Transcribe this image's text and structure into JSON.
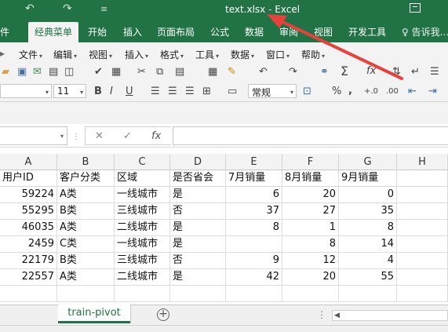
{
  "window": {
    "title": "text.xlsx - Excel",
    "quick_access": [
      "↶",
      "↷",
      "≡"
    ]
  },
  "ribbon_tabs": [
    "件",
    "经典菜单",
    "开始",
    "插入",
    "页面布局",
    "公式",
    "数据",
    "审阅",
    "视图",
    "开发工具"
  ],
  "tell_me": "告诉我...",
  "classic_menu": [
    "文件",
    "编辑",
    "视图",
    "插入",
    "格式",
    "工具",
    "数据",
    "窗口",
    "帮助"
  ],
  "toolbar": {
    "font_size": "11",
    "number_format": "常规",
    "percent": "%",
    "comma": ","
  },
  "formula_bar": {
    "fx_label": "fx",
    "cancel_label": "✕",
    "enter_label": "✓",
    "value": ""
  },
  "grid": {
    "columns": [
      "A",
      "B",
      "C",
      "D",
      "E",
      "F",
      "G",
      "H"
    ],
    "header_row": [
      "用户ID",
      "客户分类",
      "区域",
      "是否省会",
      "7月销量",
      "8月销量",
      "9月销量",
      ""
    ],
    "rows": [
      [
        "59224",
        "A类",
        "一线城市",
        "是",
        "6",
        "20",
        "0",
        ""
      ],
      [
        "55295",
        "B类",
        "三线城市",
        "否",
        "37",
        "27",
        "35",
        ""
      ],
      [
        "46035",
        "A类",
        "二线城市",
        "是",
        "8",
        "1",
        "8",
        ""
      ],
      [
        "2459",
        "C类",
        "一线城市",
        "是",
        "",
        "8",
        "14",
        ""
      ],
      [
        "22179",
        "B类",
        "三线城市",
        "否",
        "9",
        "12",
        "4",
        ""
      ],
      [
        "22557",
        "A类",
        "二线城市",
        "是",
        "42",
        "20",
        "55",
        ""
      ]
    ]
  },
  "sheets": {
    "active": "train-pivot",
    "add_label": "+",
    "more": "⋮"
  },
  "colors": {
    "excel_green": "#217346",
    "annotation_arrow": "#e8403a"
  }
}
